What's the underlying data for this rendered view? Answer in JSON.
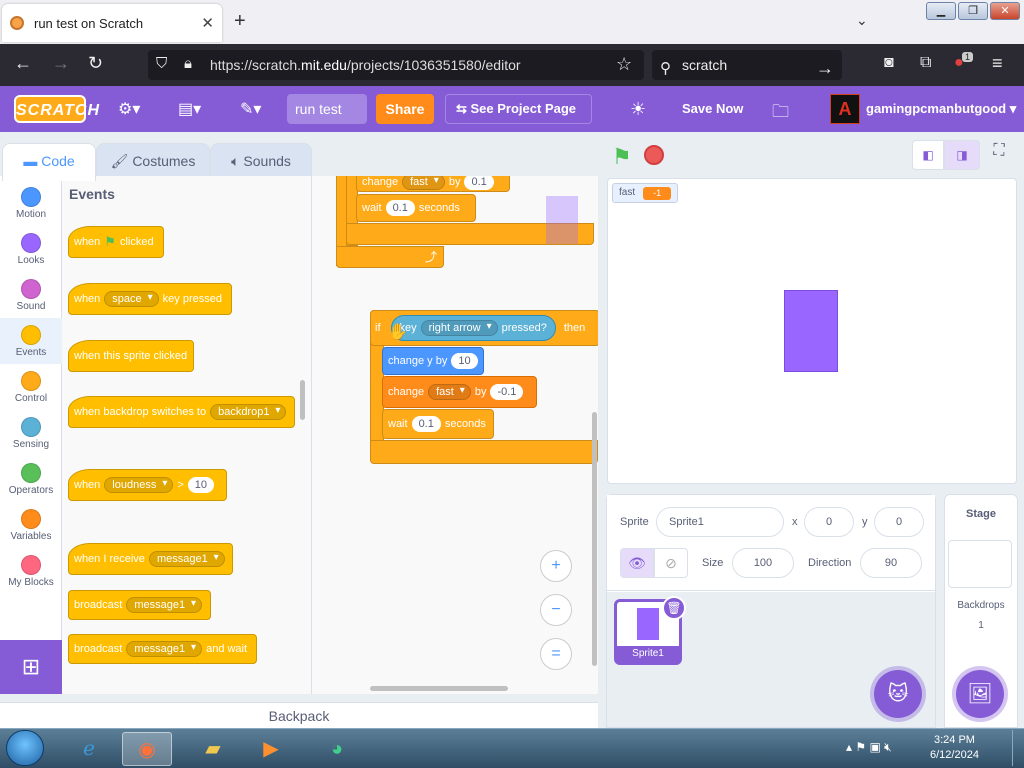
{
  "browser": {
    "tab_title": "run test on Scratch",
    "url_prefix": "https://scratch.",
    "url_domain": "mit.edu",
    "url_suffix": "/projects/1036351580/editor",
    "search_text": "scratch",
    "extension_badge": "1"
  },
  "menubar": {
    "logo": "SCRATCH",
    "project_title": "run test",
    "share": "Share",
    "see_project_page": "See Project Page",
    "save_now": "Save Now",
    "username": "gamingpcmanbutgood"
  },
  "editor_tabs": [
    "Code",
    "Costumes",
    "Sounds"
  ],
  "categories": [
    {
      "label": "Motion",
      "color": "#4c97ff"
    },
    {
      "label": "Looks",
      "color": "#9966ff"
    },
    {
      "label": "Sound",
      "color": "#cf63cf"
    },
    {
      "label": "Events",
      "color": "#ffbf00"
    },
    {
      "label": "Control",
      "color": "#ffab19"
    },
    {
      "label": "Sensing",
      "color": "#5cb1d6"
    },
    {
      "label": "Operators",
      "color": "#59c059"
    },
    {
      "label": "Variables",
      "color": "#ff8c1a"
    },
    {
      "label": "My Blocks",
      "color": "#ff6680"
    }
  ],
  "palette": {
    "title": "Events",
    "b1": {
      "a": "when",
      "b": "clicked"
    },
    "b2": {
      "a": "when",
      "dd": "space",
      "b": "key pressed"
    },
    "b3": {
      "a": "when this sprite clicked"
    },
    "b4": {
      "a": "when backdrop switches to",
      "dd": "backdrop1"
    },
    "b5": {
      "a": "when",
      "dd": "loudness",
      "op": ">",
      "num": "10"
    },
    "b6": {
      "a": "when I receive",
      "dd": "message1"
    },
    "b7": {
      "a": "broadcast",
      "dd": "message1"
    },
    "b8": {
      "a": "broadcast",
      "dd": "message1",
      "b": "and wait"
    }
  },
  "script": {
    "top_change": {
      "a": "change",
      "dd": "fast",
      "b": "by",
      "num": "0.1"
    },
    "top_wait": {
      "a": "wait",
      "num": "0.1",
      "b": "seconds"
    },
    "if_key": {
      "a": "if",
      "k": "key",
      "dd": "right arrow",
      "b": "pressed?",
      "c": "then"
    },
    "change_y": {
      "a": "change y by",
      "num": "10"
    },
    "change_fast": {
      "a": "change",
      "dd": "fast",
      "b": "by",
      "num": "-0.1"
    },
    "wait2": {
      "a": "wait",
      "num": "0.1",
      "b": "seconds"
    }
  },
  "zoom": {
    "in": "+",
    "out": "−",
    "reset": "="
  },
  "backpack": "Backpack",
  "stage": {
    "monitor_name": "fast",
    "monitor_value": "-1"
  },
  "sprite_info": {
    "sprite_label": "Sprite",
    "sprite_name": "Sprite1",
    "x_label": "x",
    "x": "0",
    "y_label": "y",
    "y": "0",
    "size_label": "Size",
    "size": "100",
    "direction_label": "Direction",
    "direction": "90"
  },
  "sprite_list": [
    {
      "name": "Sprite1"
    }
  ],
  "stage_pane": {
    "title": "Stage",
    "backdrops_label": "Backdrops",
    "backdrops_count": "1"
  },
  "taskbar": {
    "time": "3:24 PM",
    "date": "6/12/2024"
  },
  "colors": {
    "scratch_purple": "#855cd6",
    "events_yellow": "#ffbf00",
    "control_orange": "#ffab19",
    "variables_orange": "#ff8c1a",
    "motion_blue": "#4c97ff",
    "sensing_cyan": "#5cb1d6"
  }
}
